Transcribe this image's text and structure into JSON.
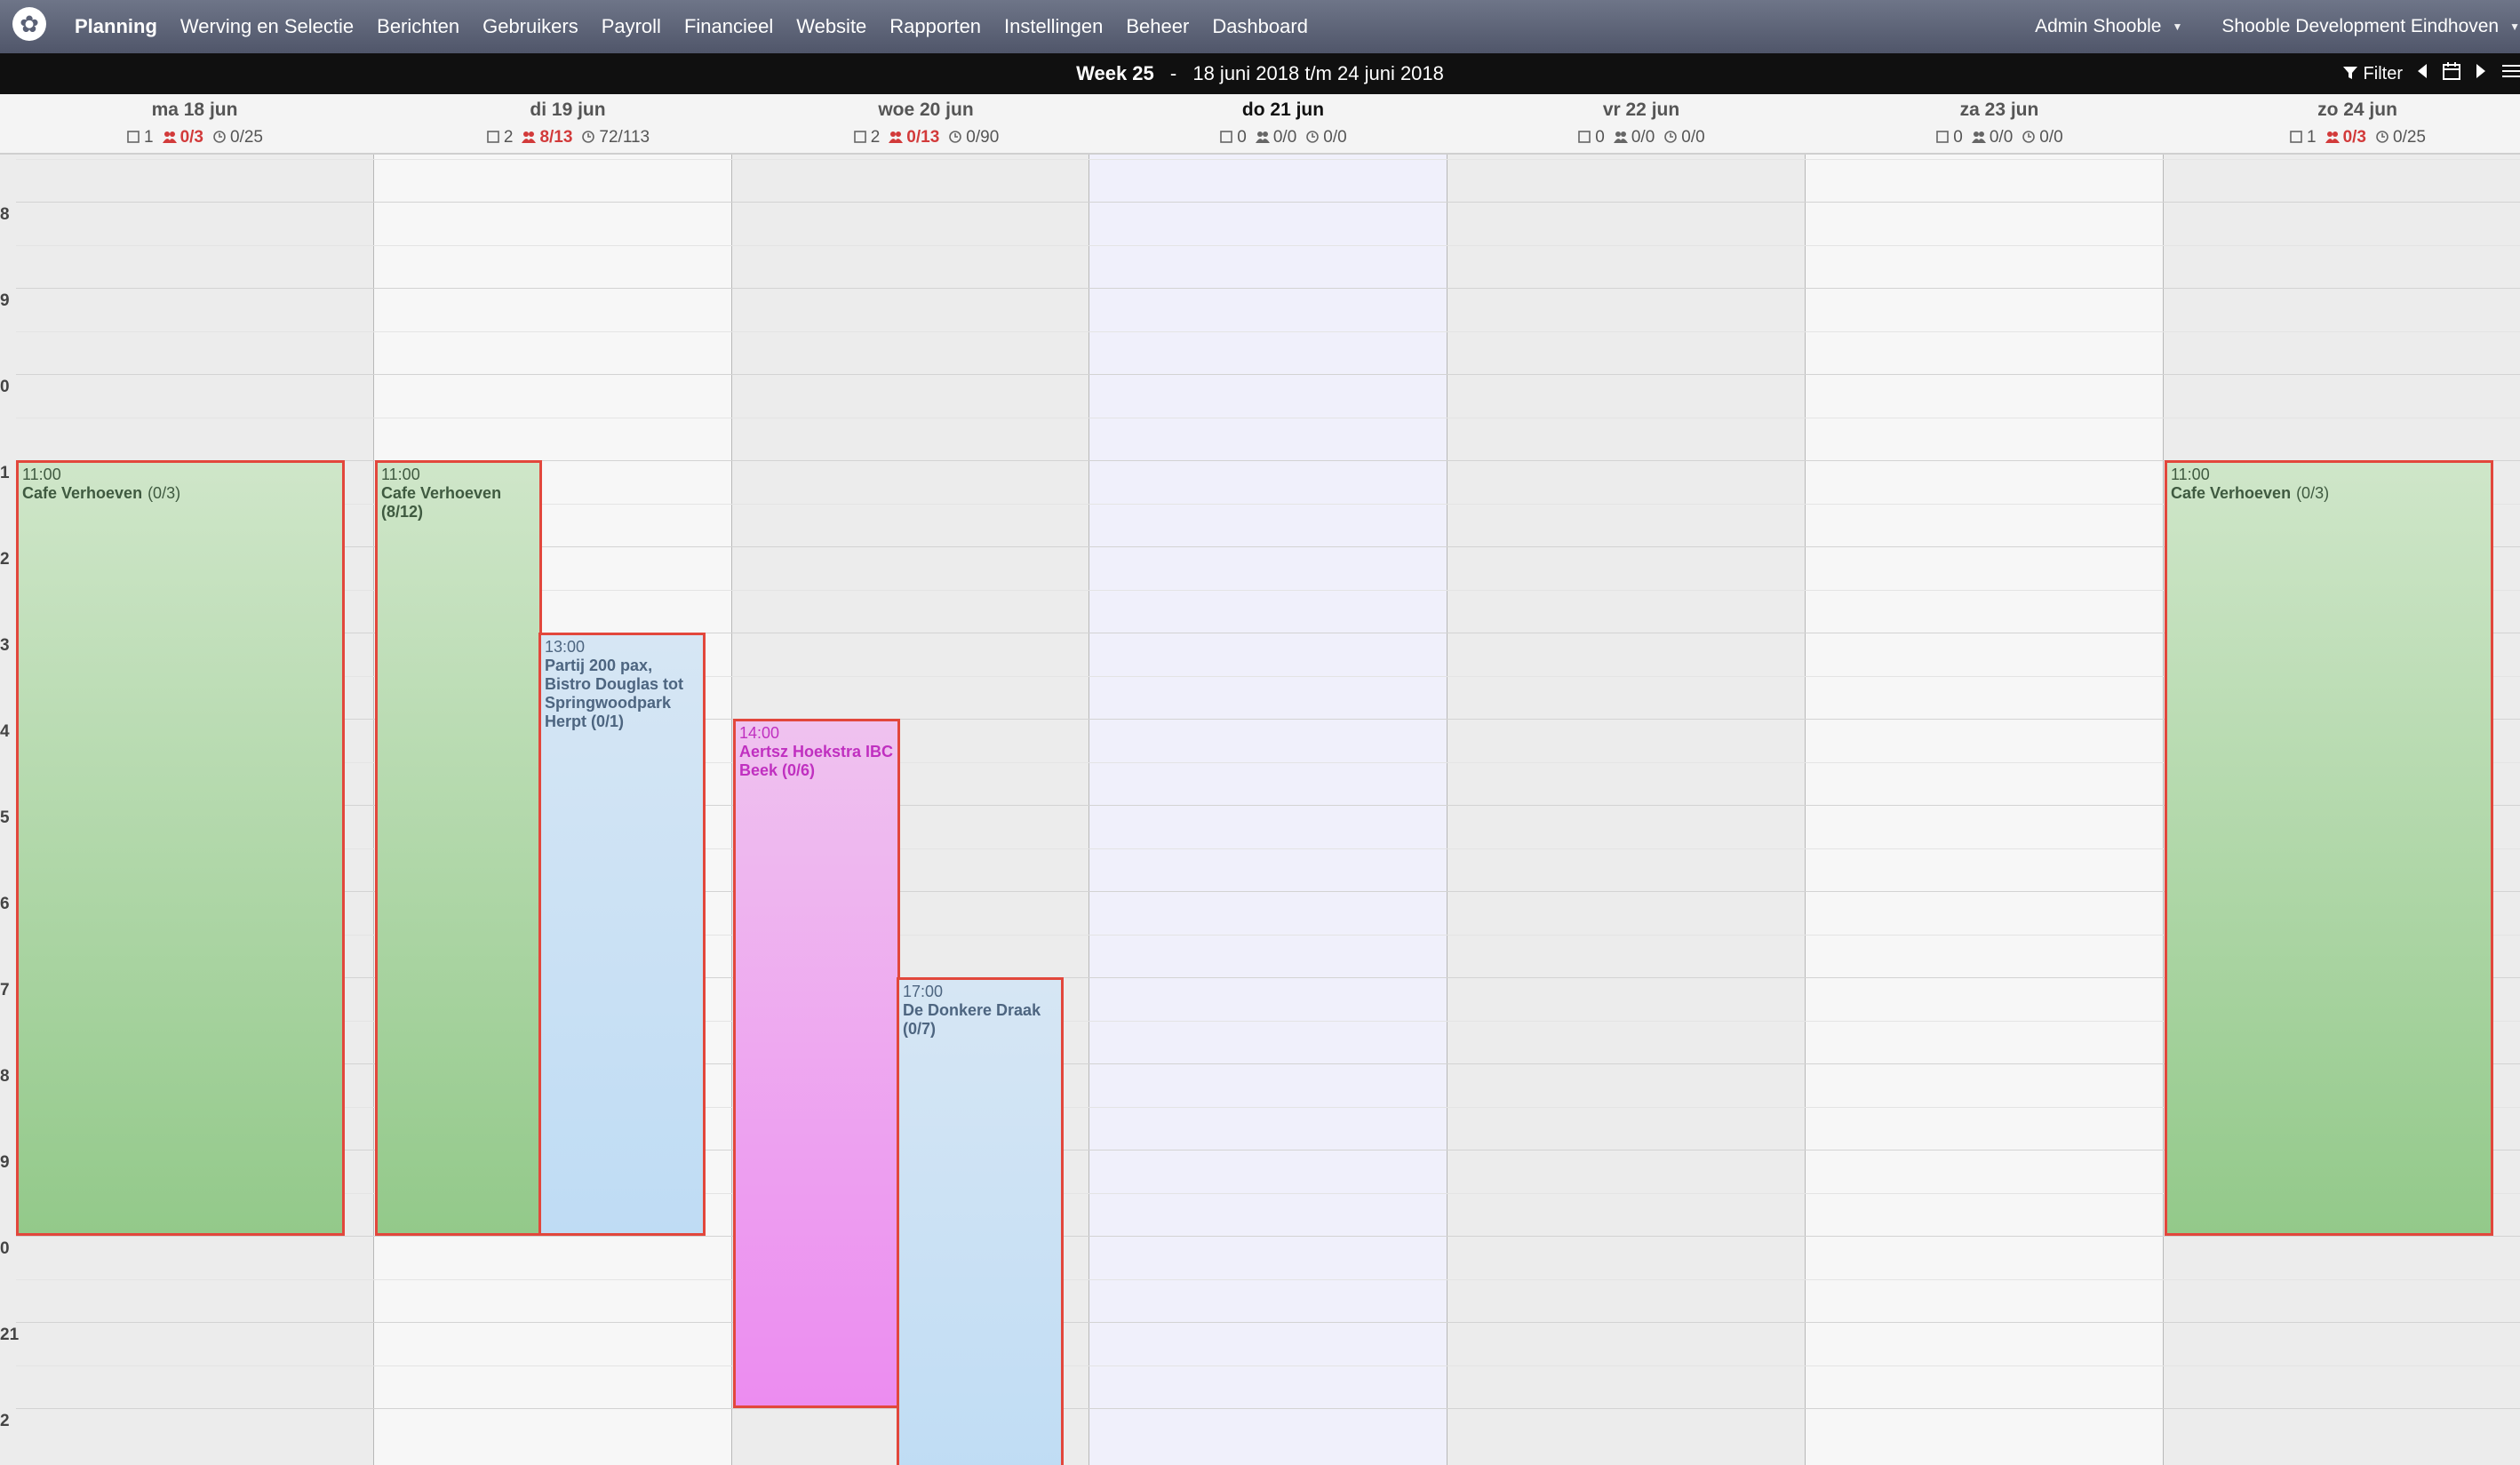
{
  "nav": {
    "logo_icon": "clover-logo-icon",
    "items": [
      "Planning",
      "Werving en Selectie",
      "Berichten",
      "Gebruikers",
      "Payroll",
      "Financieel",
      "Website",
      "Rapporten",
      "Instellingen",
      "Beheer",
      "Dashboard"
    ],
    "active": "Planning",
    "user": "Admin Shooble",
    "org": "Shooble Development Eindhoven"
  },
  "weekbar": {
    "week": "Week 25",
    "separator": "-",
    "range": "18 juni 2018 t/m 24 juni 2018",
    "filter_label": "Filter"
  },
  "days": [
    {
      "name": "ma 18 jun",
      "docs": "1",
      "people": "0/3",
      "people_alert": true,
      "hours": "0/25",
      "today": false
    },
    {
      "name": "di 19 jun",
      "docs": "2",
      "people": "8/13",
      "people_alert": true,
      "hours": "72/113",
      "today": false
    },
    {
      "name": "woe 20 jun",
      "docs": "2",
      "people": "0/13",
      "people_alert": true,
      "hours": "0/90",
      "today": false
    },
    {
      "name": "do 21 jun",
      "docs": "0",
      "people": "0/0",
      "people_alert": false,
      "hours": "0/0",
      "today": true
    },
    {
      "name": "vr 22 jun",
      "docs": "0",
      "people": "0/0",
      "people_alert": false,
      "hours": "0/0",
      "today": false
    },
    {
      "name": "za 23 jun",
      "docs": "0",
      "people": "0/0",
      "people_alert": false,
      "hours": "0/0",
      "today": false
    },
    {
      "name": "zo 24 jun",
      "docs": "1",
      "people": "0/3",
      "people_alert": true,
      "hours": "0/25",
      "today": false
    }
  ],
  "hour_labels": [
    "8",
    "9",
    "0",
    "1",
    "2",
    "3",
    "4",
    "5",
    "6",
    "7",
    "8",
    "9",
    "0",
    "21",
    "2"
  ],
  "events": [
    {
      "day": 0,
      "lane": 0,
      "start": "11:00",
      "end": "20:00",
      "time": "11:00",
      "title": "Cafe Verhoeven",
      "count": "(0/3)",
      "style": "green"
    },
    {
      "day": 1,
      "lane": 0,
      "start": "11:00",
      "end": "20:00",
      "time": "11:00",
      "title": "Cafe Verhoeven (8/12)",
      "count": "",
      "style": "green"
    },
    {
      "day": 1,
      "lane": 1,
      "start": "13:00",
      "end": "20:00",
      "time": "13:00",
      "title": "Partij 200 pax, Bistro Douglas tot Springwoodpark Herpt (0/1)",
      "count": "",
      "style": "blue"
    },
    {
      "day": 2,
      "lane": 0,
      "start": "14:00",
      "end": "22:00",
      "time": "14:00",
      "title": "Aertsz Hoekstra IBC Beek (0/6)",
      "count": "",
      "style": "pink"
    },
    {
      "day": 2,
      "lane": 1,
      "start": "17:00",
      "end": "23:00",
      "time": "17:00",
      "title": "De Donkere Draak (0/7)",
      "count": "",
      "style": "blue"
    },
    {
      "day": 6,
      "lane": 0,
      "start": "11:00",
      "end": "20:00",
      "time": "11:00",
      "title": "Cafe Verhoeven",
      "count": "(0/3)",
      "style": "green"
    }
  ],
  "icons": {
    "docs": "document-icon",
    "people": "people-icon",
    "hours": "clock-icon",
    "filter": "filter-icon",
    "prev": "chevron-left-icon",
    "calendar": "calendar-icon",
    "next": "chevron-right-icon",
    "menu": "hamburger-menu-icon"
  },
  "colors": {
    "event_border": "#e2473c",
    "alert": "#d23a3a",
    "today_column": "#f0f0fb"
  }
}
